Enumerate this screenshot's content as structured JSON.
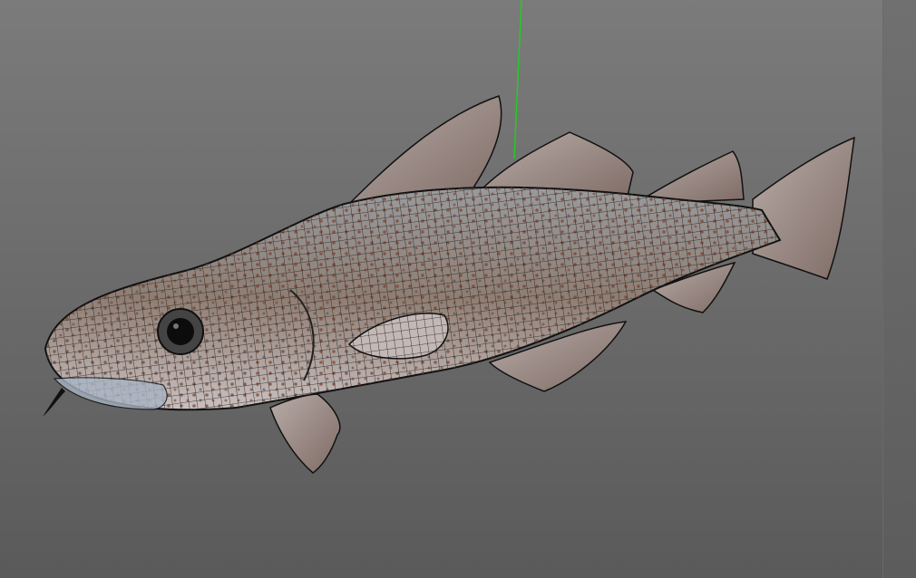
{
  "viewport": {
    "background_top": "#7b7b7b",
    "background_bottom": "#5a5a5a",
    "axis_color": "#22cc22",
    "model": {
      "name_icon": "fish-mesh-icon",
      "body_color": "#8a7c74",
      "wire_color": "#1a1a1a",
      "spot_color": "#7a3f2a"
    }
  },
  "side_panel": {
    "color": "#6e6e6e"
  }
}
